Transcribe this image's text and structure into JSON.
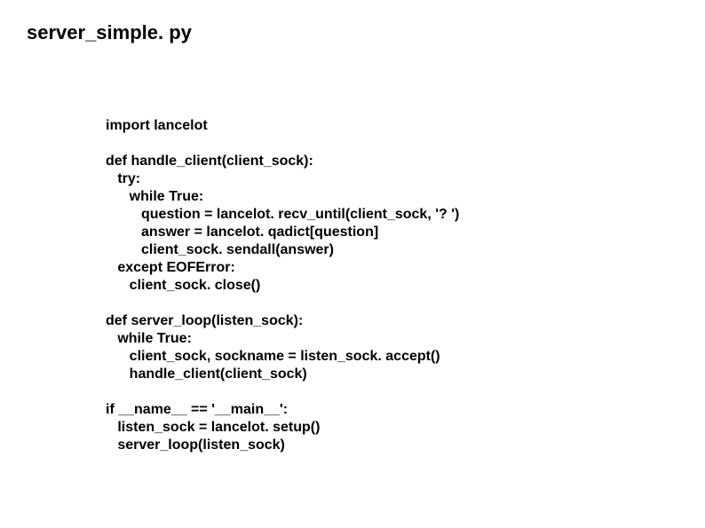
{
  "title": "server_simple. py",
  "code": {
    "lines": [
      "import lancelot",
      "",
      "def handle_client(client_sock):",
      "   try:",
      "      while True:",
      "         question = lancelot. recv_until(client_sock, '? ')",
      "         answer = lancelot. qadict[question]",
      "         client_sock. sendall(answer)",
      "   except EOFError:",
      "      client_sock. close()",
      "",
      "def server_loop(listen_sock):",
      "   while True:",
      "      client_sock, sockname = listen_sock. accept()",
      "      handle_client(client_sock)",
      "",
      "if __name__ == '__main__':",
      "   listen_sock = lancelot. setup()",
      "   server_loop(listen_sock)"
    ]
  }
}
